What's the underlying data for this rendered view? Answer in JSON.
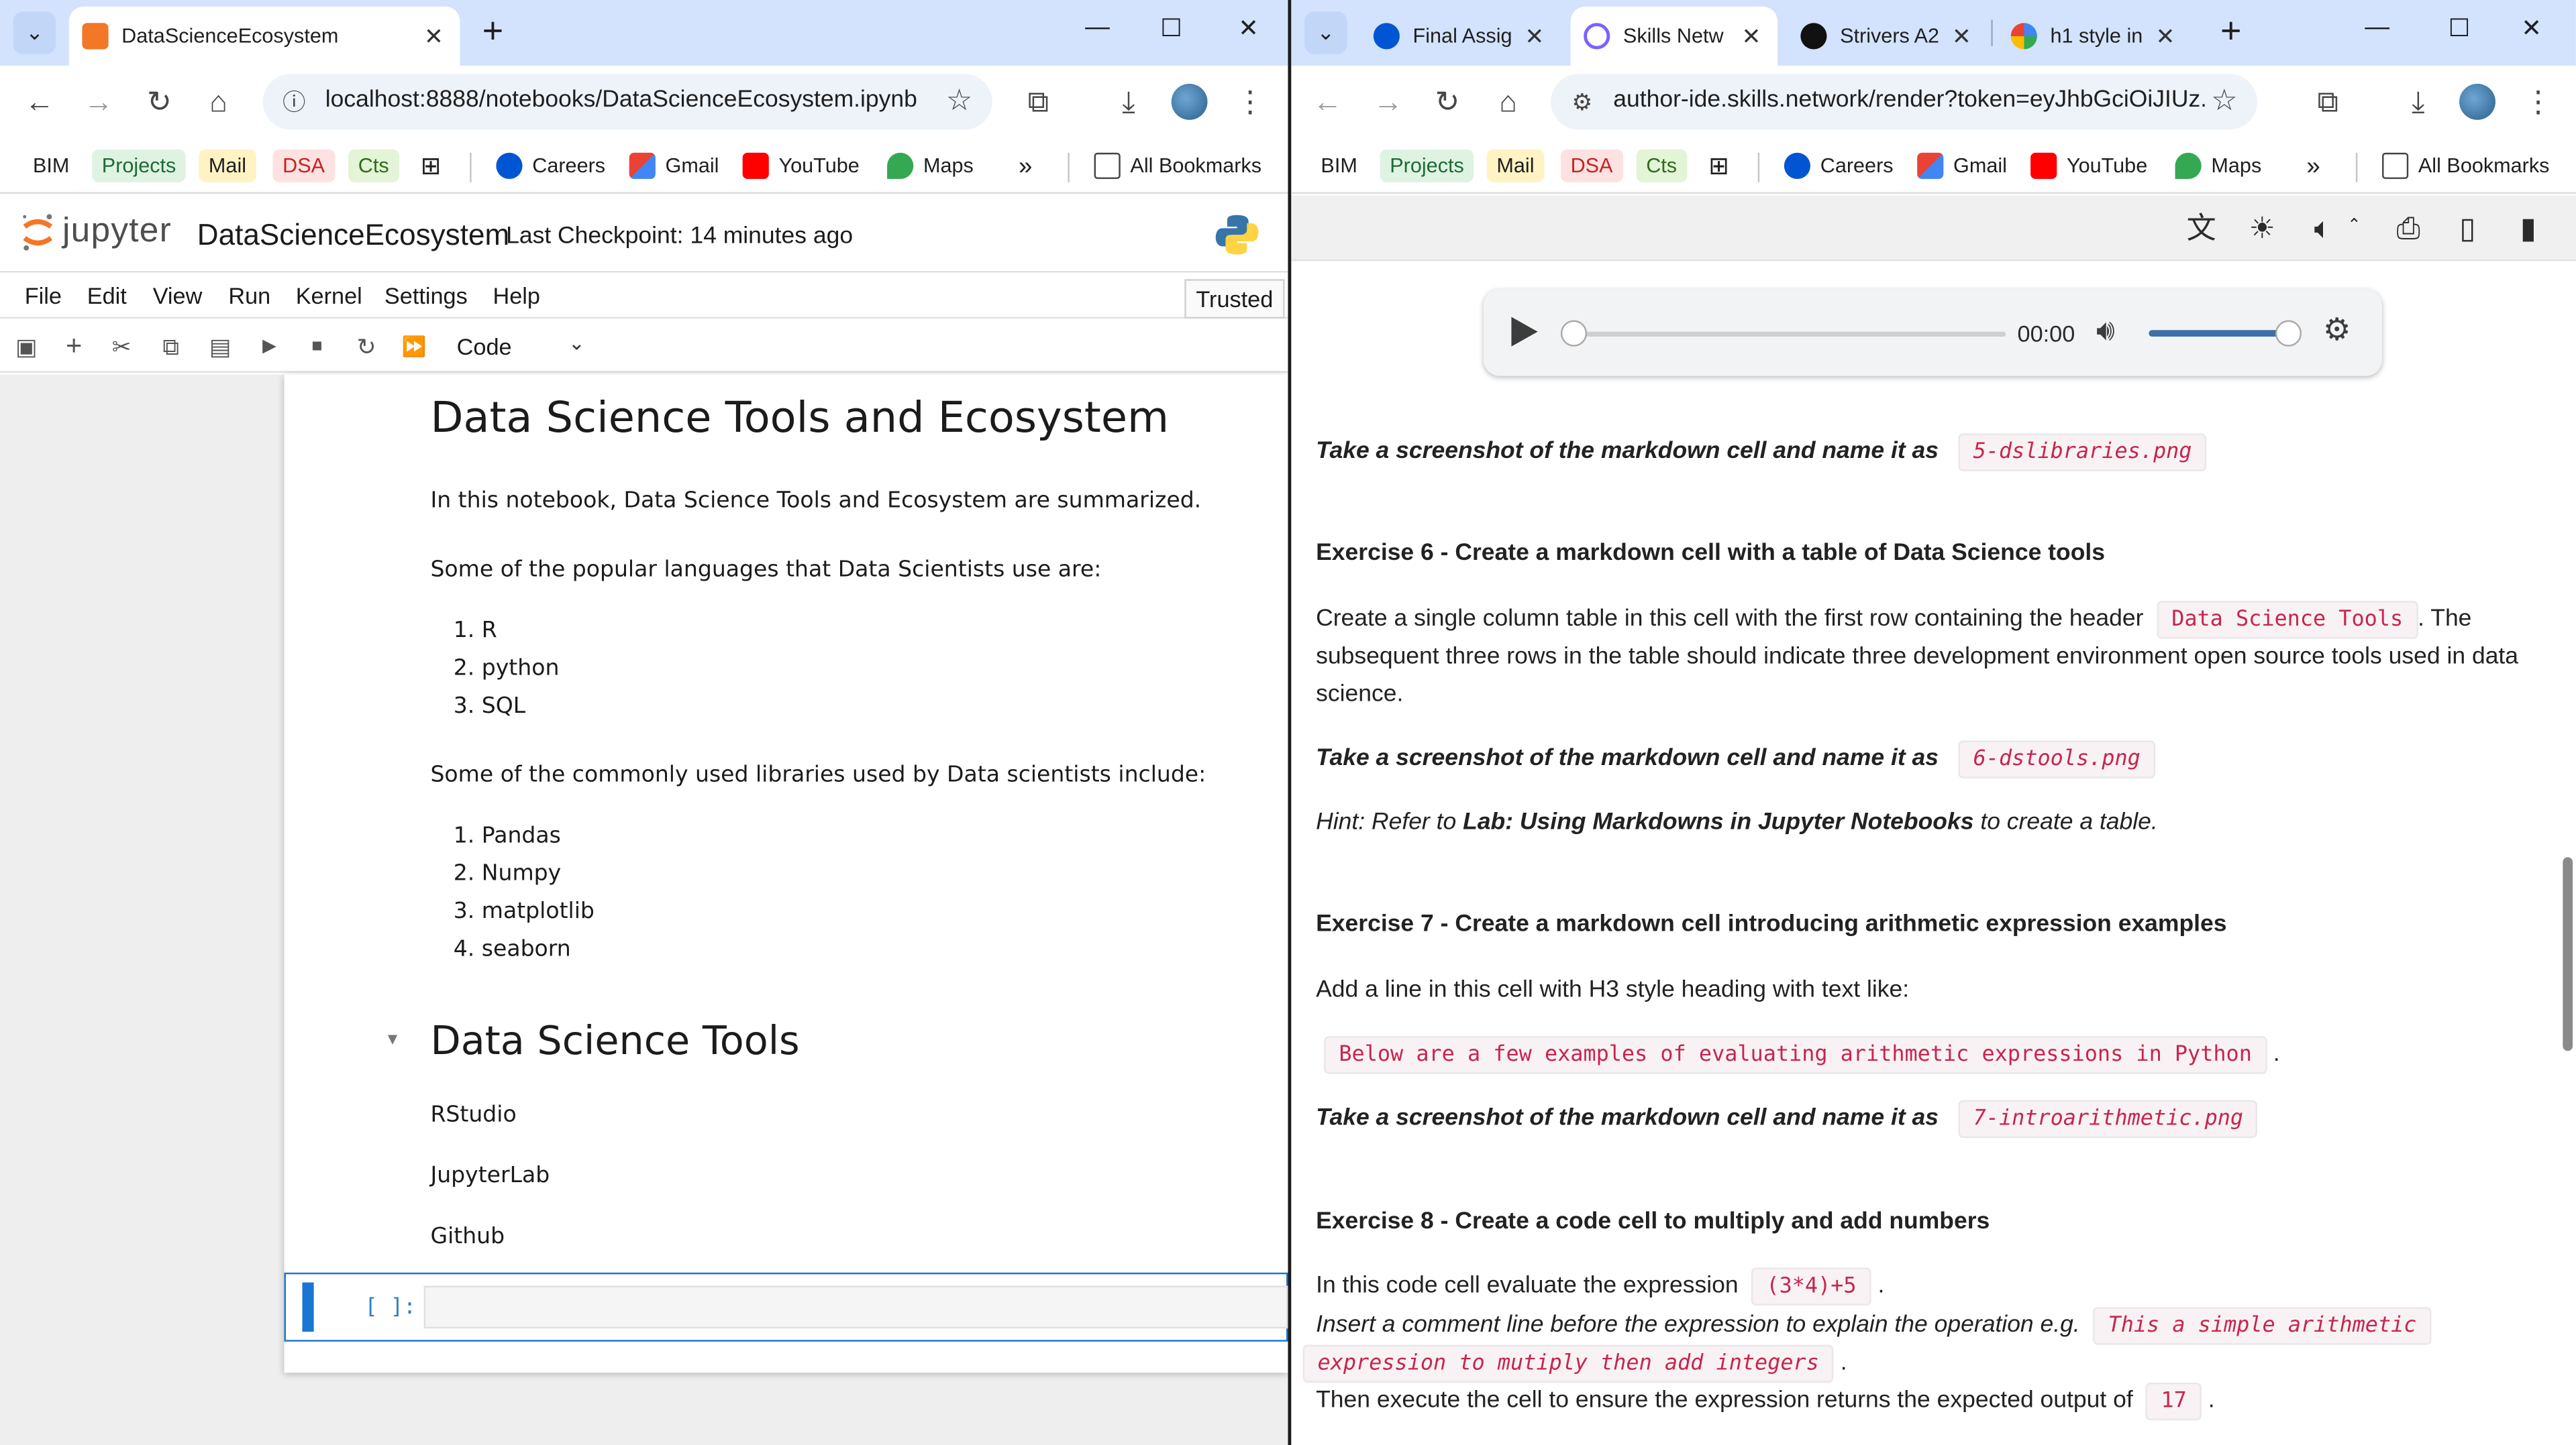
{
  "left_window": {
    "tabs": [
      {
        "title": "DataScienceEcosystem",
        "favicon": "jupyter-orange-icon",
        "active": true
      }
    ],
    "address": "localhost:8888/notebooks/DataScienceEcosystem.ipynb",
    "bookmarks": [
      "BIM",
      "Projects",
      "Mail",
      "DSA",
      "Cts",
      "Careers",
      "Gmail",
      "YouTube",
      "Maps",
      "All Bookmarks"
    ],
    "window_controls": [
      "minimize",
      "maximize",
      "close"
    ]
  },
  "right_window": {
    "tabs": [
      {
        "title": "Final Assig",
        "favicon": "coursera-icon",
        "active": false
      },
      {
        "title": "Skills Netw",
        "favicon": "skills-network-icon",
        "active": true
      },
      {
        "title": "Strivers A2",
        "favicon": "tuf-icon",
        "active": false
      },
      {
        "title": "h1 style in",
        "favicon": "google-icon",
        "active": false
      }
    ],
    "address": "author-ide.skills.network/render?token=eyJhbGciOiJIUz...",
    "bookmarks": [
      "BIM",
      "Projects",
      "Mail",
      "DSA",
      "Cts",
      "Careers",
      "Gmail",
      "YouTube",
      "Maps",
      "All Bookmarks"
    ]
  },
  "jupyter": {
    "logo_text": "jupyter",
    "notebook_title": "DataScienceEcosystem",
    "checkpoint": "Last Checkpoint: 14 minutes ago",
    "menu": [
      "File",
      "Edit",
      "View",
      "Run",
      "Kernel",
      "Settings",
      "Help"
    ],
    "trusted": "Trusted",
    "cell_type": "Code",
    "heading": "Data Science Tools and Ecosystem",
    "intro": "In this notebook, Data Science Tools and Ecosystem are summarized.",
    "languages_intro": "Some of the popular languages that Data Scientists use are:",
    "languages": [
      "1. R",
      "2. python",
      "3. SQL"
    ],
    "libraries_intro": "Some of the commonly used libraries used by Data scientists include:",
    "libraries": [
      "1. Pandas",
      "2. Numpy",
      "3. matplotlib",
      "4. seaborn"
    ],
    "tools_heading": "Data Science Tools",
    "tools": [
      "RStudio",
      "JupyterLab",
      "Github"
    ],
    "prompt": "[ ]:"
  },
  "lab": {
    "audio_time": "00:00",
    "ex5_screenshot_lead": "Take a screenshot of the markdown cell and name it as",
    "ex5_file": "5-dslibraries.png",
    "ex6_title": "Exercise 6 - Create a markdown cell with a table of Data Science tools",
    "ex6_body_1a": "Create a single column table in this cell with the first row containing the header",
    "ex6_code": "Data Science Tools",
    "ex6_body_1b": ". The",
    "ex6_body_2": "subsequent three rows in the table should indicate three development environment open source tools used in data",
    "ex6_body_3": "science.",
    "ex6_screenshot_lead": "Take a screenshot of the markdown cell and name it as",
    "ex6_file": "6-dstools.png",
    "ex6_hint_a": "Hint: Refer to ",
    "ex6_hint_b": "Lab: Using Markdowns in Jupyter Notebooks",
    "ex6_hint_c": " to create a table.",
    "ex7_title": "Exercise 7 - Create a markdown cell introducing arithmetic expression examples",
    "ex7_body": "Add a line in this cell with H3 style heading with text like:",
    "ex7_code": "Below are a few examples of evaluating arithmetic expressions in Python",
    "ex7_dot": ".",
    "ex7_screenshot_lead": "Take a screenshot of the markdown cell and name it as",
    "ex7_file": "7-introarithmetic.png",
    "ex8_title": "Exercise 8 - Create a code cell to multiply and add numbers",
    "ex8_body_1": "In this code cell evaluate the expression",
    "ex8_code_expr": "(3*4)+5",
    "ex8_dot": ".",
    "ex8_body_2": "Insert a comment line before the expression to explain the operation e.g.",
    "ex8_comment_1": "This a simple arithmetic",
    "ex8_comment_2": "expression to mutiply then add integers",
    "ex8_body_3": "Then execute the cell to ensure the expression returns the expected output of",
    "ex8_output": "17"
  }
}
